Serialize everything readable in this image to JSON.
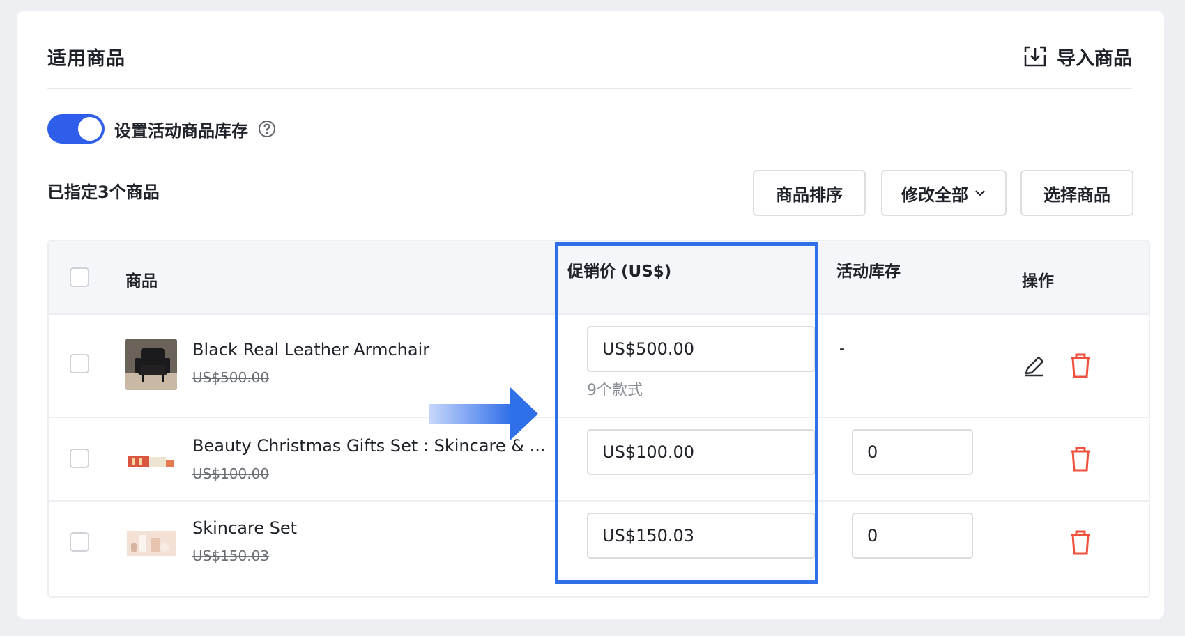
{
  "header": {
    "title": "适用商品",
    "import_label": "导入商品"
  },
  "stock_toggle": {
    "label": "设置活动商品库存",
    "on": true
  },
  "summary": {
    "count_text": "已指定3个商品"
  },
  "actions": {
    "sort_label": "商品排序",
    "edit_all_label": "修改全部",
    "select_label": "选择商品"
  },
  "table": {
    "headers": {
      "product": "商品",
      "promo_price": "促销价 (US$)",
      "stock": "活动库存",
      "actions": "操作"
    },
    "rows": [
      {
        "name": "Black Real Leather Armchair",
        "original_price": "US$500.00",
        "promo_price": "US$500.00",
        "variant_note": "9个款式",
        "stock": "-",
        "has_edit": true
      },
      {
        "name": "Beauty Christmas Gifts Set : Skincare & ...",
        "original_price": "US$100.00",
        "promo_price": "US$100.00",
        "stock": "0",
        "has_edit": false
      },
      {
        "name": "Skincare Set",
        "original_price": "US$150.03",
        "promo_price": "US$150.03",
        "stock": "0",
        "has_edit": false
      }
    ]
  },
  "colors": {
    "accent": "#2f5eea",
    "highlight": "#2f6fe8",
    "danger": "#f0503c"
  },
  "icons": [
    "download-icon",
    "help-circle-icon",
    "chevron-down-icon",
    "edit-pencil-icon",
    "trash-icon",
    "arrow-right-icon"
  ]
}
